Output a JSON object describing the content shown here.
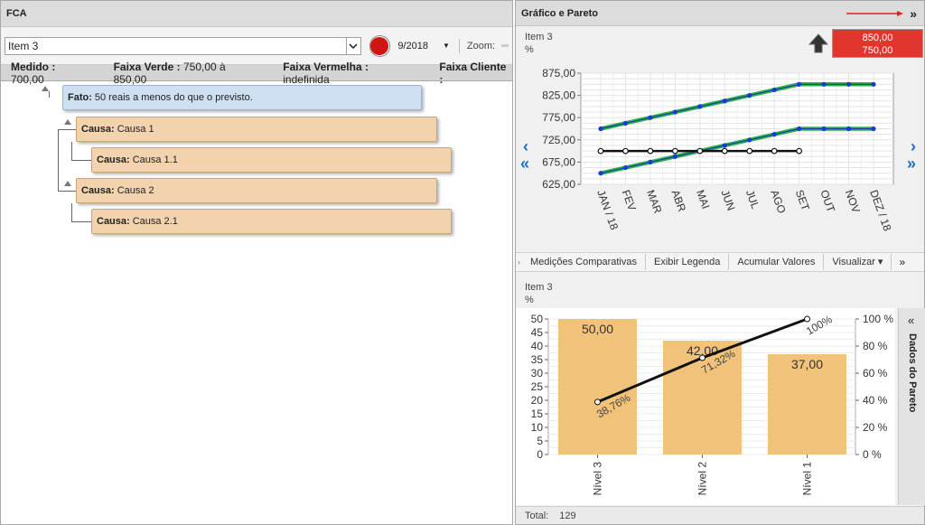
{
  "left": {
    "title": "FCA",
    "item_select": "Item 3",
    "period": "9/2018",
    "zoom_label": "Zoom:",
    "status_color": "#d11515",
    "summary": [
      {
        "label": "Medido :",
        "value": "700,00"
      },
      {
        "label": "Faixa Verde :",
        "value": "750,00 à 850,00"
      },
      {
        "label": "Faixa Vermelha :",
        "value": "indefinida"
      },
      {
        "label": "Faixa Cliente :",
        "value": ""
      }
    ],
    "tree": {
      "fact": {
        "label": "Fato:",
        "text": "50 reais a menos do que o previsto."
      },
      "causes": [
        {
          "label": "Causa:",
          "text": "Causa 1"
        },
        {
          "label": "Causa:",
          "text": "Causa 1.1"
        },
        {
          "label": "Causa:",
          "text": "Causa 2"
        },
        {
          "label": "Causa:",
          "text": "Causa 2.1"
        }
      ]
    }
  },
  "right": {
    "title": "Gráfico e Pareto",
    "collapse_icon": "»",
    "chart_item": "Item 3",
    "chart_unit": "%",
    "trend_icon": "arrow-up-icon",
    "range_high": "850,00",
    "range_low": "750,00",
    "range_color": "#e0362d",
    "tabs": [
      "Medições Comparativas",
      "Exibir Legenda",
      "Acumular Valores",
      "Visualizar ▾"
    ],
    "tabs_more": "»",
    "pareto_item": "Item 3",
    "pareto_unit": "%",
    "pareto_side_label": "Dados do Pareto",
    "pareto_side_icon": "«",
    "total_label": "Total:",
    "total_value": "129"
  },
  "chart_data": [
    {
      "type": "line",
      "categories": [
        "JAN / 18",
        "FEV",
        "MAR",
        "ABR",
        "MAI",
        "JUN",
        "JUL",
        "AGO",
        "SET",
        "OUT",
        "NOV",
        "DEZ / 18"
      ],
      "ylim": [
        625,
        875
      ],
      "yticks": [
        "875,00",
        "825,00",
        "775,00",
        "725,00",
        "675,00",
        "625,00"
      ],
      "series": [
        {
          "name": "",
          "color": "#2db34a",
          "values": [
            750,
            762.5,
            775,
            787.5,
            800,
            812.5,
            825,
            837.5,
            850,
            850,
            850,
            850
          ]
        },
        {
          "name": "",
          "color": "#2db34a",
          "values": [
            650,
            662.5,
            675,
            687.5,
            700,
            712.5,
            725,
            737.5,
            750,
            750,
            750,
            750
          ]
        },
        {
          "name": "",
          "color": "#111111",
          "values": [
            700,
            700,
            700,
            700,
            700,
            700,
            700,
            700,
            700,
            null,
            null,
            null
          ]
        }
      ],
      "grid": true
    },
    {
      "type": "bar",
      "categories": [
        "Nível 3",
        "Nível 2",
        "Nível 1"
      ],
      "values": [
        50,
        42,
        37
      ],
      "value_labels": [
        "50,00",
        "42,00",
        "37,00"
      ],
      "ylim": [
        0,
        50
      ],
      "yticks": [
        "50",
        "45",
        "40",
        "35",
        "30",
        "25",
        "20",
        "15",
        "10",
        "5",
        "0"
      ],
      "y2ticks": [
        "100 %",
        "80 %",
        "60 %",
        "40 %",
        "20 %",
        "0 %"
      ],
      "cumulative": [
        38.76,
        71.32,
        100
      ],
      "cumulative_labels": [
        "38,76%",
        "71,32%",
        "100%"
      ],
      "bar_color": "#f0c27a"
    }
  ]
}
